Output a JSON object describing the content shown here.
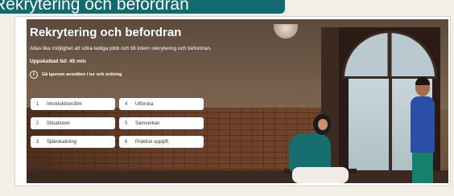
{
  "caption": {
    "text": "Rekrytering och befordran"
  },
  "course": {
    "title": "Rekrytering och befordran",
    "description": "Allas lika möjlighet att söka lediga jobb och till intern rekrytering och befordran.",
    "duration": "Uppskattad tid: 45 min",
    "info_text": "Gå igenom avsnitten i tur och ordning",
    "info_icon": "info-icon"
  },
  "modules": [
    {
      "num": "1",
      "label": "Introduktionsfilm"
    },
    {
      "num": "4",
      "label": "Utforska"
    },
    {
      "num": "2",
      "label": "Situationer"
    },
    {
      "num": "5",
      "label": "Samverkan"
    },
    {
      "num": "3",
      "label": "Självskattning"
    },
    {
      "num": "6",
      "label": "Praktisk uppgift"
    }
  ],
  "colors": {
    "caption_bg": "#0f6b70",
    "button_bg": "#ffffff",
    "title_text": "#ffffff"
  }
}
